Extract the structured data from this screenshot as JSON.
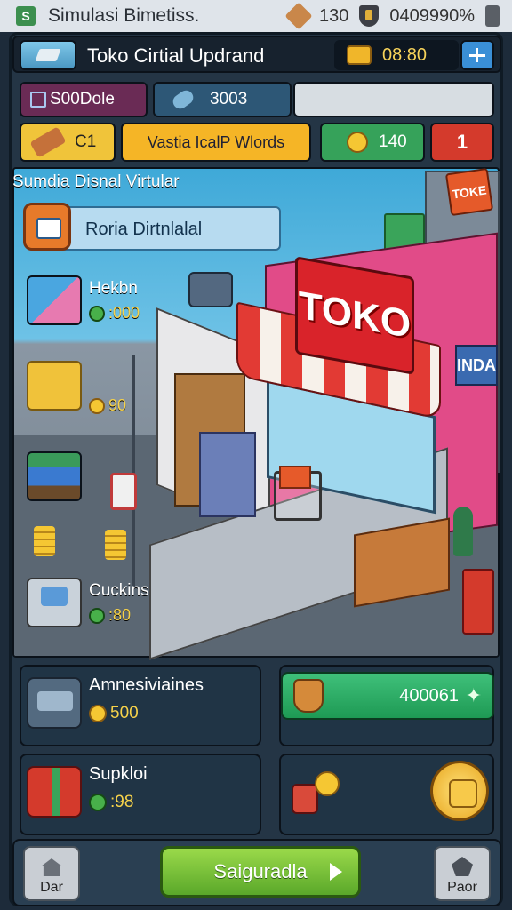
{
  "status_bar": {
    "title": "Simulasi Bimetiss.",
    "count": "130",
    "battery": "0409990%"
  },
  "header": {
    "title": "Toko Cirtial Updrand",
    "time": "08:80"
  },
  "resources": {
    "pill_a": "S00Dole",
    "pill_b": "3003"
  },
  "actions": {
    "tool_value": "C1",
    "words_label": "Vastia IcalP Wlords",
    "coins_value": "140",
    "red_value": "1"
  },
  "scene": {
    "caption": "Sumdia Disnal Virtular",
    "info_panel": "Roria Dirtnlalal",
    "shop_sign": "TOKO",
    "tower_sign": "TOKE",
    "india_sign": "INDA"
  },
  "items": [
    {
      "name": "Hekbn",
      "price": ":000"
    },
    {
      "name": "",
      "price": "90"
    },
    {
      "name": "Cuckins",
      "price": ":80"
    }
  ],
  "cards": {
    "card_1": {
      "name": "Amnesiviaines",
      "price": "500"
    },
    "card_2": {
      "value": "400061"
    },
    "card_3": {
      "name": "Supkloi",
      "price": ":98"
    }
  },
  "bottom_bar": {
    "left_label": "Dar",
    "main_label": "Saiguradla",
    "right_label": "Paor"
  },
  "colors": {
    "primary_green": "#3fc07a",
    "accent_gold": "#f5c733",
    "toko_red": "#d9232a"
  }
}
